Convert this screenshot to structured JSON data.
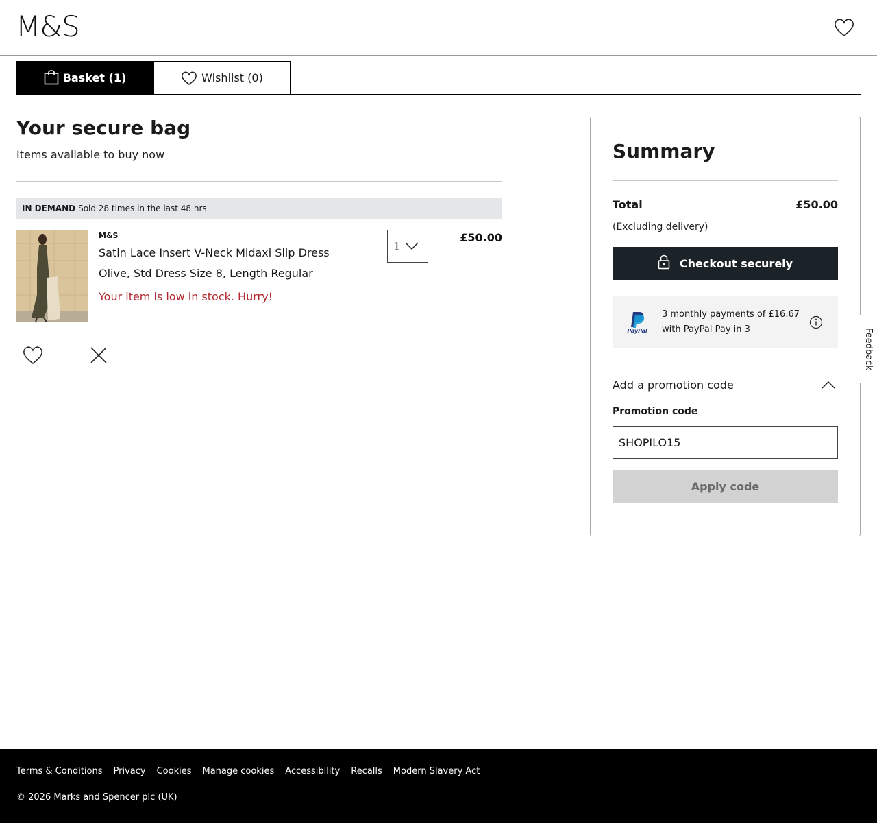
{
  "header": {
    "logo": "M&S"
  },
  "tabs": [
    {
      "label": "Basket (1)"
    },
    {
      "label": "Wishlist (0)"
    }
  ],
  "bag": {
    "title": "Your secure bag",
    "subtitle": "Items available to buy now"
  },
  "demand": {
    "tag": "IN DEMAND",
    "text": "Sold 28 times in the last 48 hrs"
  },
  "item": {
    "brand": "M&S",
    "name": "Satin Lace Insert V-Neck Midaxi Slip Dress",
    "variant": "Olive, Std Dress Size 8, Length Regular",
    "stock_message": "Your item is low in stock. Hurry!",
    "quantity": "1",
    "price": "£50.00"
  },
  "summary": {
    "title": "Summary",
    "total_label": "Total",
    "total_value": "£50.00",
    "delivery_note": "(Excluding delivery)",
    "checkout_label": "Checkout securely",
    "paypal_line1": "3 monthly payments of £16.67",
    "paypal_line2": "with PayPal Pay in 3",
    "promo_toggle": "Add a promotion code",
    "promo_label": "Promotion code",
    "promo_value": "SHOPILO15",
    "apply_label": "Apply code"
  },
  "feedback": {
    "label": "Feedback"
  },
  "footer": {
    "links": [
      "Terms & Conditions",
      "Privacy",
      "Cookies",
      "Manage cookies",
      "Accessibility",
      "Recalls",
      "Modern Slavery Act"
    ],
    "copyright": "© 2026 Marks and Spencer plc (UK)"
  },
  "colors": {
    "accent_dark": "#1b2329",
    "stock_warning": "#b02a30",
    "banner_bg": "#e4e6e8"
  },
  "icons": [
    "heart-icon",
    "shopping-bag-icon",
    "chevron-down-icon",
    "close-icon",
    "padlock-icon",
    "paypal-logo-icon",
    "info-icon",
    "chevron-up-icon"
  ]
}
